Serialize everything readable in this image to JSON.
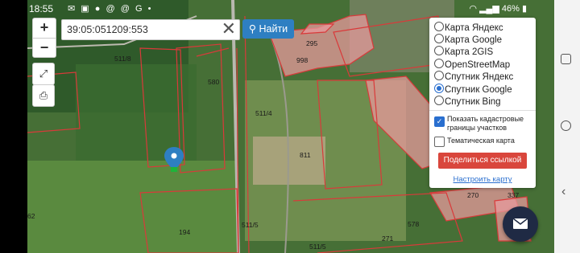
{
  "status_bar": {
    "time": "18:55",
    "icons": [
      "envelope-icon",
      "photo-icon",
      "gallery-icon",
      "at-icon",
      "at-icon",
      "google-icon"
    ],
    "battery": "46%"
  },
  "search": {
    "value": "39:05:051209:553",
    "button_label": "Найти"
  },
  "zoom": {
    "in_label": "+",
    "out_label": "−"
  },
  "layers_panel": {
    "items": [
      {
        "label": "Карта Яндекс",
        "selected": false
      },
      {
        "label": "Карта Google",
        "selected": false
      },
      {
        "label": "Карта 2GIS",
        "selected": false
      },
      {
        "label": "OpenStreetMap",
        "selected": false
      },
      {
        "label": "Спутник Яндекс",
        "selected": false
      },
      {
        "label": "Спутник Google",
        "selected": true
      },
      {
        "label": "Спутник Bing",
        "selected": false
      }
    ],
    "show_borders_label": "Показать кадастровые границы участков",
    "show_borders_checked": true,
    "thematic_label": "Тематическая карта",
    "thematic_checked": false,
    "share_label": "Поделиться ссылкой",
    "configure_label": "Настроить карту"
  },
  "map_labels": [
    "511/8",
    "580",
    "998",
    "295",
    "511/4",
    "811",
    "194",
    "511/5",
    "578",
    "271",
    "337",
    "270",
    "62",
    "511/5"
  ],
  "colors": {
    "accent": "#2e7fc2",
    "share": "#d9463c",
    "parcel_fill": "#e79a9c",
    "parcel_stroke": "#d93a3a"
  }
}
